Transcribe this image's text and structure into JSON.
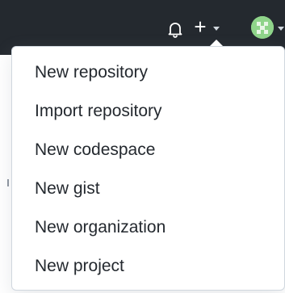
{
  "header": {
    "icons": {
      "notifications": "bell-icon",
      "create": "plus-icon",
      "create_caret": "caret-down-icon",
      "avatar": "avatar",
      "avatar_caret": "caret-down-icon"
    },
    "plus_glyph": "+",
    "colors": {
      "bar": "#24292f",
      "avatar": "#8fd48a"
    }
  },
  "create_menu": {
    "items": [
      {
        "label": "New repository"
      },
      {
        "label": "Import repository"
      },
      {
        "label": "New codespace"
      },
      {
        "label": "New gist"
      },
      {
        "label": "New organization"
      },
      {
        "label": "New project"
      }
    ]
  }
}
